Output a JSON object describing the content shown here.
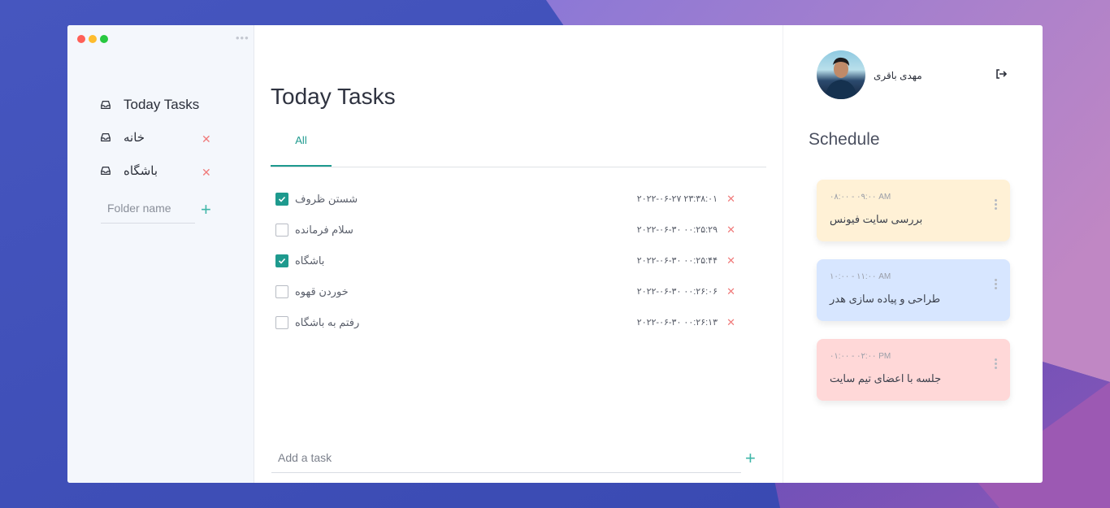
{
  "window": {
    "controls": [
      "close",
      "minimize",
      "maximize"
    ],
    "colors": {
      "close": "#ff5f57",
      "minimize": "#febc2e",
      "maximize": "#28c840"
    }
  },
  "sidebar": {
    "items": [
      {
        "label": "Today Tasks",
        "icon": "inbox-icon",
        "deletable": false
      },
      {
        "label": "خانه",
        "icon": "inbox-icon",
        "deletable": true
      },
      {
        "label": "باشگاه",
        "icon": "inbox-icon",
        "deletable": true
      }
    ],
    "folder_input_placeholder": "Folder name",
    "add_icon": "plus-icon"
  },
  "main": {
    "title": "Today Tasks",
    "tabs": [
      {
        "label": "All",
        "active": true
      }
    ],
    "tasks": [
      {
        "title": "شستن ظروف",
        "time": "۲۰۲۲-۰۶-۲۷ ۲۳:۳۸:۰۱",
        "done": true
      },
      {
        "title": "سلام فرمانده",
        "time": "۲۰۲۲-۰۶-۳۰ ۰۰:۲۵:۲۹",
        "done": false
      },
      {
        "title": "باشگاه",
        "time": "۲۰۲۲-۰۶-۳۰ ۰۰:۲۵:۴۴",
        "done": true
      },
      {
        "title": "خوردن قهوه",
        "time": "۲۰۲۲-۰۶-۳۰ ۰۰:۲۶:۰۶",
        "done": false
      },
      {
        "title": "رفتم به باشگاه",
        "time": "۲۰۲۲-۰۶-۳۰ ۰۰:۲۶:۱۳",
        "done": false
      }
    ],
    "add_task_placeholder": "Add a task"
  },
  "profile": {
    "name": "مهدی باقری",
    "logout_icon": "logout-icon"
  },
  "schedule": {
    "title": "Schedule",
    "events": [
      {
        "time": "۰۸:۰۰ - ۰۹:۰۰ AM",
        "title": "بررسی سایت فیونس",
        "color": "#fff1d6"
      },
      {
        "time": "۱۰:۰۰ - ۱۱:۰۰ AM",
        "title": "طراحی و پیاده سازی هدر",
        "color": "#d7e6ff"
      },
      {
        "time": "۰۱:۰۰ - ۰۲:۰۰ PM",
        "title": "جلسه با اعضای تیم سایت",
        "color": "#ffd8d8"
      }
    ]
  },
  "colors": {
    "accent": "#1e9a8e",
    "delete": "#f07b7b",
    "sidebar_bg": "#f4f7fc"
  }
}
